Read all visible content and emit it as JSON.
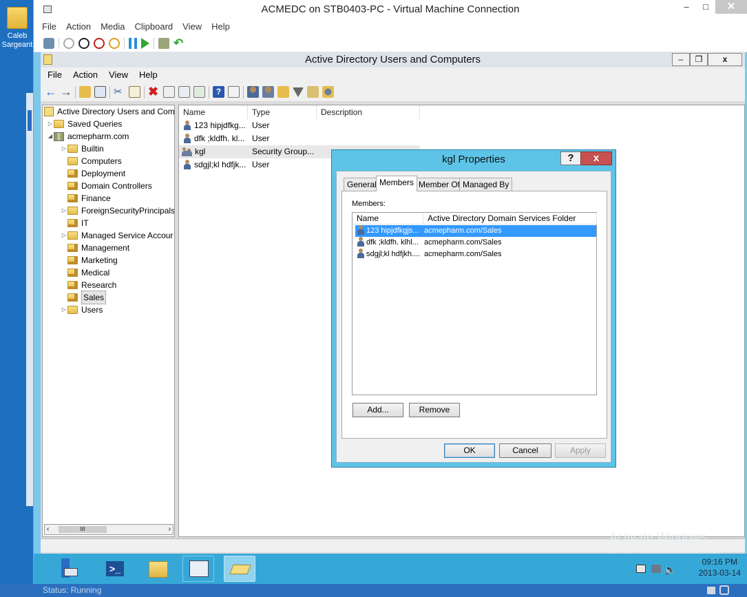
{
  "desktop": {
    "icon_label": "Caleb Sargeant"
  },
  "host": {
    "status": "Status: Running"
  },
  "vm_window": {
    "title": "ACMEDC on STB0403-PC - Virtual Machine Connection",
    "menu": [
      "File",
      "Action",
      "Media",
      "Clipboard",
      "View",
      "Help"
    ]
  },
  "aduc": {
    "title": "Active Directory Users and Computers",
    "menu": [
      "File",
      "Action",
      "View",
      "Help"
    ],
    "tree": {
      "root": "Active Directory Users and Com",
      "saved_queries": "Saved Queries",
      "domain": "acmepharm.com",
      "items": [
        "Builtin",
        "Computers",
        "Deployment",
        "Domain Controllers",
        "Finance",
        "ForeignSecurityPrincipals",
        "IT",
        "Managed Service Accour",
        "Management",
        "Marketing",
        "Medical",
        "Research",
        "Sales",
        "Users"
      ],
      "scroll_thumb": "III"
    },
    "list": {
      "headers": [
        "Name",
        "Type",
        "Description"
      ],
      "rows": [
        {
          "name": "123 hipjdfkg...",
          "type": "User"
        },
        {
          "name": "dfk ;kldfh. kl...",
          "type": "User"
        },
        {
          "name": "kgl",
          "type": "Security Group..."
        },
        {
          "name": "sdgjl;kl hdfjk...",
          "type": "User"
        }
      ]
    }
  },
  "dialog": {
    "title": "kgl Properties",
    "help": "?",
    "close": "x",
    "tabs": [
      "General",
      "Members",
      "Member Of",
      "Managed By"
    ],
    "members_label": "Members:",
    "columns": [
      "Name",
      "Active Directory Domain Services Folder"
    ],
    "members": [
      {
        "name": "123 hipjdfkgjs...",
        "folder": "acmepharm.com/Sales"
      },
      {
        "name": "dfk ;kldfh. klhl...",
        "folder": "acmepharm.com/Sales"
      },
      {
        "name": "sdgjl;kl hdfjkh....",
        "folder": "acmepharm.com/Sales"
      }
    ],
    "add": "Add...",
    "remove": "Remove",
    "ok": "OK",
    "cancel": "Cancel",
    "apply": "Apply"
  },
  "taskbar": {
    "time": "09:16 PM",
    "date": "2013-03-14"
  },
  "watermark": {
    "line1": "Activate Windows",
    "line2": "Go to PC settings to activate"
  }
}
